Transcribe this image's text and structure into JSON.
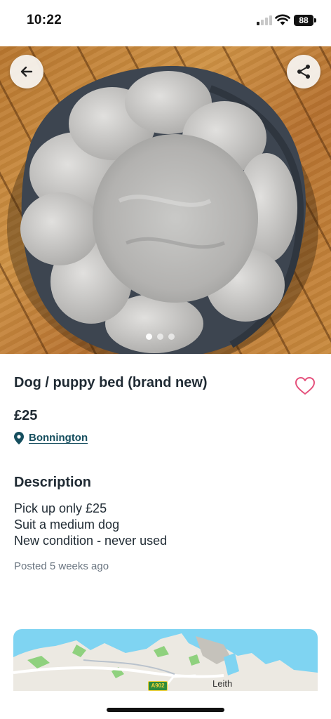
{
  "status_bar": {
    "time": "10:22",
    "battery": "88"
  },
  "hero": {
    "back_icon": "arrow-left-icon",
    "share_icon": "share-icon",
    "photo_count": 3,
    "active_photo": 1
  },
  "listing": {
    "title": "Dog / puppy bed (brand new)",
    "price": "£25",
    "location": "Bonnington",
    "favourite_icon": "heart-outline-icon"
  },
  "description": {
    "heading": "Description",
    "lines": [
      "Pick up only £25",
      "Suit a medium dog",
      "New condition - never used"
    ]
  },
  "posted": "Posted 5 weeks ago",
  "map": {
    "place_label": "Leith",
    "road_badge": "A902"
  },
  "colors": {
    "text": "#1f2a33",
    "link": "#154e5e",
    "heart": "#e5527d",
    "muted": "#6a7580"
  }
}
